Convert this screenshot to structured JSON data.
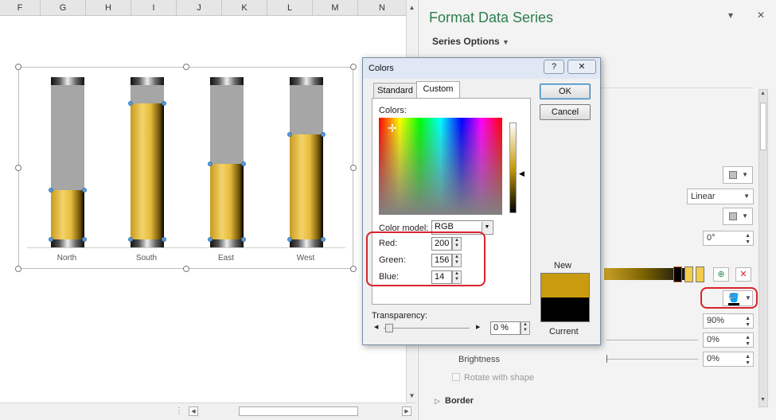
{
  "sheet": {
    "columns": [
      "F",
      "G",
      "H",
      "I",
      "J",
      "K",
      "L",
      "M",
      "N"
    ]
  },
  "chart": {
    "categories": [
      "North",
      "South",
      "East",
      "West"
    ],
    "fill_fraction": [
      0.32,
      0.88,
      0.49,
      0.68
    ]
  },
  "pane": {
    "title": "Format Data Series",
    "series_options": "Series Options",
    "gradient_type": "Linear",
    "angle": "0°",
    "position": "90%",
    "transparency": "0%",
    "brightness_value": "0%",
    "brightness_label": "Brightness",
    "rotate_label": "Rotate with shape",
    "border_label": "Border"
  },
  "dialog": {
    "title": "Colors",
    "help_button": "?",
    "tabs": [
      "Standard",
      "Custom"
    ],
    "colors_label": "Colors:",
    "color_model_label": "Color model:",
    "color_model_value": "RGB",
    "red_label": "Red:",
    "red_value": "200",
    "green_label": "Green:",
    "green_value": "156",
    "blue_label": "Blue:",
    "blue_value": "14",
    "transparency_label": "Transparency:",
    "transparency_value": "0 %",
    "ok": "OK",
    "cancel": "Cancel",
    "new_label": "New",
    "current_label": "Current",
    "new_color": "#c89c0e",
    "current_color": "#000000"
  }
}
